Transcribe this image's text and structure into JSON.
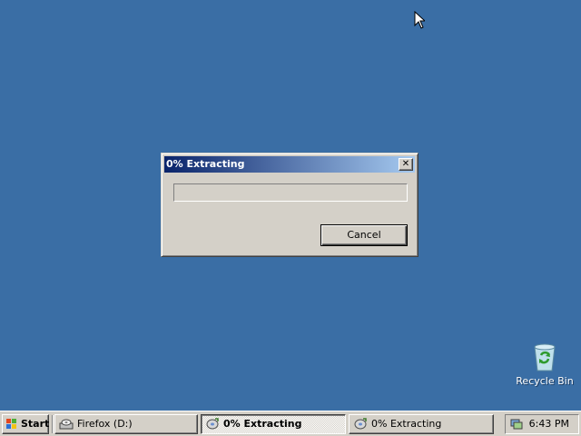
{
  "desktop": {
    "background_color": "#3a6ea5",
    "icons": [
      {
        "label": "Recycle Bin",
        "icon": "recycle-bin-icon"
      }
    ]
  },
  "dialog": {
    "title": "0% Extracting",
    "progress_fraction": 0.0,
    "close_label": "✕",
    "cancel_label": "Cancel"
  },
  "taskbar": {
    "start_label": "Start",
    "tasks": [
      {
        "label": "Firefox (D:)",
        "icon": "drive-icon",
        "active": false
      },
      {
        "label": "0% Extracting",
        "icon": "extract-icon",
        "active": true
      },
      {
        "label": "0% Extracting",
        "icon": "extract-icon",
        "active": false
      }
    ],
    "clock": "6:43 PM"
  },
  "colors": {
    "desktop": "#3a6ea5",
    "titlebar_start": "#0a246a",
    "titlebar_end": "#a6caf0",
    "window_face": "#d4d0c8"
  }
}
